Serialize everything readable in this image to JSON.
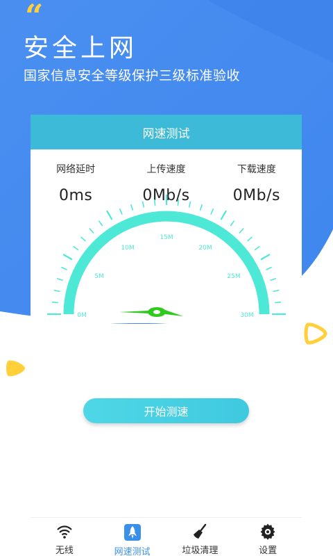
{
  "hero": {
    "quote_mark": "“",
    "title": "安全上网",
    "subtitle": "国家信息安全等级保护三级标准验收"
  },
  "card": {
    "header": "网速测试",
    "stats": [
      {
        "label": "网络延时",
        "value": "0ms"
      },
      {
        "label": "上传速度",
        "value": "0Mb/s"
      },
      {
        "label": "下载速度",
        "value": "0Mb/s"
      }
    ]
  },
  "gauge": {
    "ticks": [
      "0M",
      "5M",
      "10M",
      "15M",
      "20M",
      "25M",
      "30M"
    ],
    "current_value": 0,
    "max_value": 30,
    "arc_color": "#4ee8d6",
    "needle_color": "#2fca1e"
  },
  "start_button": {
    "label": "开始测速"
  },
  "tabbar": {
    "items": [
      {
        "label": "无线",
        "icon": "wifi-icon",
        "active": false
      },
      {
        "label": "网速测试",
        "icon": "rocket-icon",
        "active": true
      },
      {
        "label": "垃圾清理",
        "icon": "broom-icon",
        "active": false
      },
      {
        "label": "设置",
        "icon": "gear-icon",
        "active": false
      }
    ]
  },
  "colors": {
    "primary_blue": "#3f8ef1",
    "header_cyan": "#3dbad8",
    "accent_yellow": "#ffd03a"
  }
}
